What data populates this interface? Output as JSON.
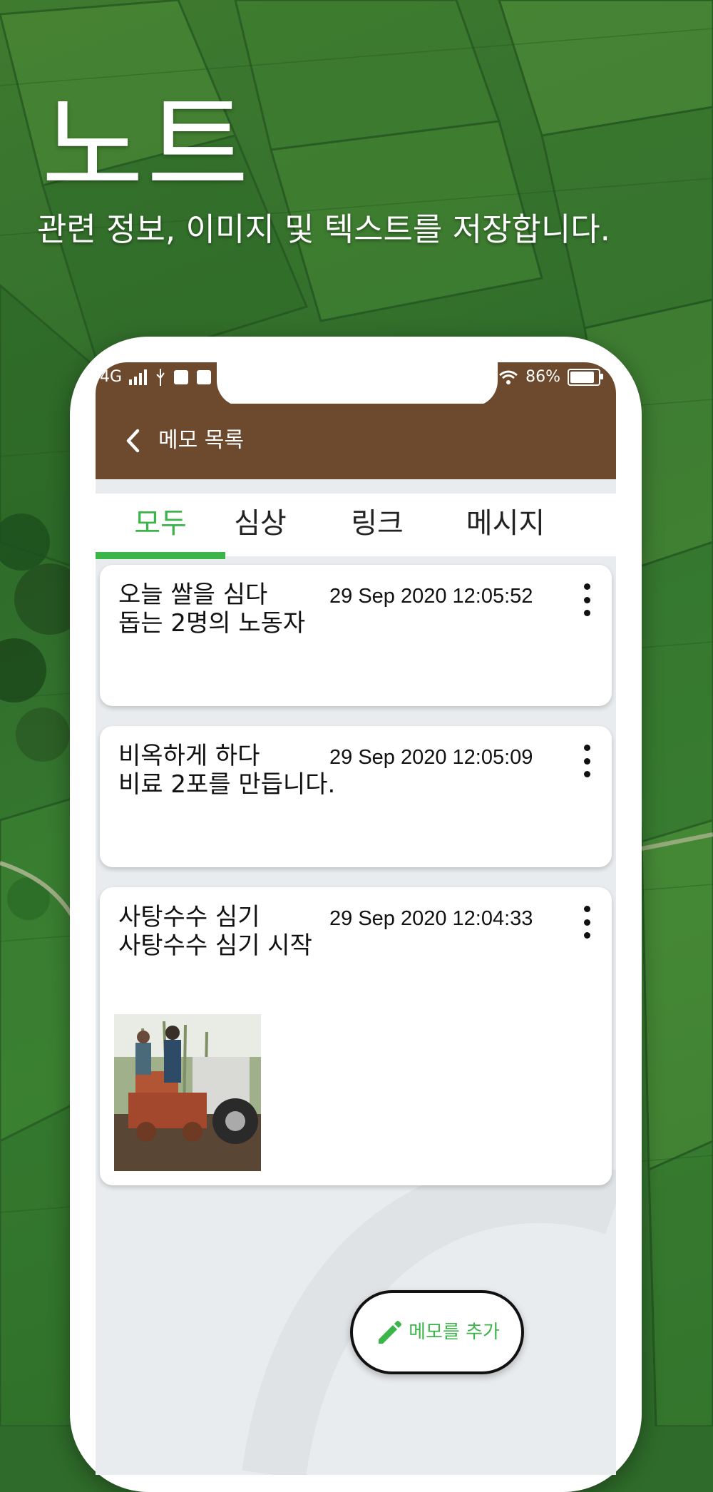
{
  "hero": {
    "title": "노트",
    "subtitle": "관련 정보, 이미지 및 텍스트를 저장합니다."
  },
  "status_bar": {
    "network": "4G",
    "battery_percent": "86%",
    "battery_level": 0.86
  },
  "app_bar": {
    "title": "메모 목록",
    "back_icon": "chevron-left-icon"
  },
  "tabs": [
    {
      "label": "모두",
      "active": true
    },
    {
      "label": "심상",
      "active": false
    },
    {
      "label": "링크",
      "active": false
    },
    {
      "label": "메시지",
      "active": false
    }
  ],
  "notes": [
    {
      "title": "오늘 쌀을 심다",
      "body": "돕는 2명의 노동자",
      "date": "29 Sep 2020 12:05:52",
      "has_image": false
    },
    {
      "title": "비옥하게 하다",
      "body": "비료 2포를 만듭니다.",
      "date": "29 Sep 2020 12:05:09",
      "has_image": false
    },
    {
      "title": "사탕수수 심기",
      "body": "사탕수수 심기 시작",
      "date": "29 Sep 2020 12:04:33",
      "has_image": true
    }
  ],
  "fab": {
    "label": "메모를 추가",
    "icon": "pencil-icon"
  },
  "colors": {
    "brown": "#6d4a2d",
    "accent_green": "#3bb54a"
  }
}
